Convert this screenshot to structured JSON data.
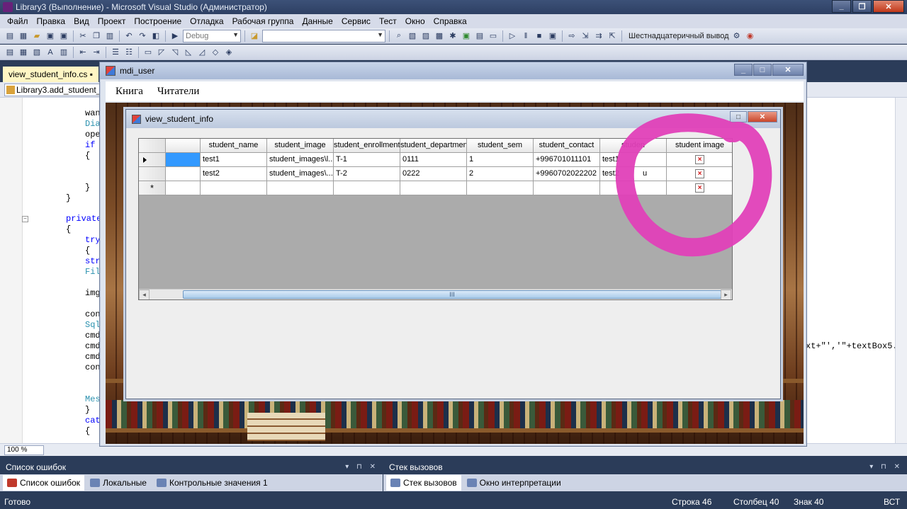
{
  "vs": {
    "title": "Library3 (Выполнение) - Microsoft Visual Studio (Администратор)",
    "menu": [
      "Файл",
      "Правка",
      "Вид",
      "Проект",
      "Построение",
      "Отладка",
      "Рабочая группа",
      "Данные",
      "Сервис",
      "Тест",
      "Окно",
      "Справка"
    ],
    "config_combo": "Debug",
    "hex_output_label": "Шестнадцатеричный вывод",
    "doc_tab": "view_student_info.cs",
    "member_combo": "Library3.add_student_i",
    "code_lines": [
      "wan",
      "Dia",
      "ope",
      "if",
      "{",
      "}",
      "}",
      "private",
      "{",
      "try",
      "{",
      "str",
      "Fil",
      "img",
      "con",
      "Sql",
      "cmd",
      "cmd",
      "cmd",
      "con",
      "Mes",
      "}",
      "cat",
      "{"
    ],
    "code_right_fragment": "xt+\"','\"+textBox5.T",
    "zoom": "100 %",
    "errors_pane_title": "Список ошибок",
    "callstack_pane_title": "Стек вызовов",
    "left_tabs": [
      "Список ошибок",
      "Локальные",
      "Контрольные значения 1"
    ],
    "right_tabs": [
      "Стек вызовов",
      "Окно интерпретации"
    ],
    "status": {
      "ready": "Готово",
      "line": "Строка 46",
      "col": "Столбец 40",
      "char": "Знак 40",
      "mode": "ВСТ"
    }
  },
  "mdi": {
    "title": "mdi_user",
    "menu": [
      "Книга",
      "Читатели"
    ]
  },
  "child": {
    "title": "view_student_info",
    "grid": {
      "columns": [
        "",
        "student_name",
        "student_image",
        "student_enrollment_",
        "student_departmen",
        "student_sem",
        "student_contact",
        "studen",
        "student image"
      ],
      "rows": [
        [
          "",
          "test1",
          "student_images\\l...",
          "T-1",
          "0111",
          "1",
          "+996701011101",
          "test1",
          ""
        ],
        [
          "",
          "test2",
          "student_images\\...",
          "T-2",
          "0222",
          "2",
          "+9960702022202",
          "test2",
          "u"
        ]
      ],
      "new_row_marker": "*",
      "image_placeholder": "×",
      "scroll_grip": "III"
    }
  },
  "colors": {
    "annotation": "#e040b8",
    "selection": "#3399ff"
  }
}
